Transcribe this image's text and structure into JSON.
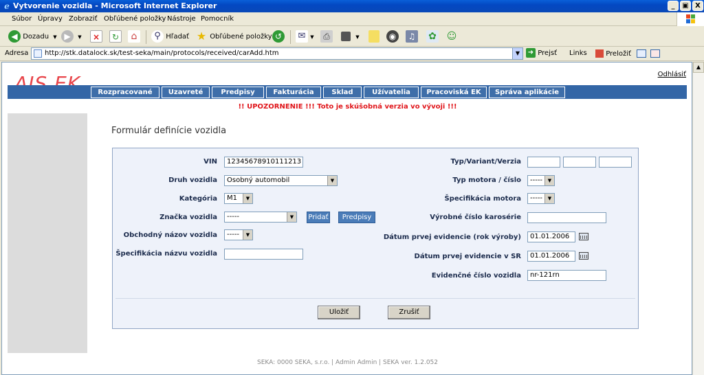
{
  "window": {
    "title": "Vytvorenie vozidla - Microsoft Internet Explorer",
    "minimize": "_",
    "maximize": "▣",
    "close": "X"
  },
  "menu": [
    "Súbor",
    "Úpravy",
    "Zobraziť",
    "Obľúbené položky",
    "Nástroje",
    "Pomocník"
  ],
  "toolbar": {
    "back": "Dozadu",
    "search": "Hľadať",
    "favorites": "Obľúbené položky"
  },
  "address": {
    "label": "Adresa",
    "url": "http://stk.datalock.sk/test-seka/main/protocols/received/carAdd.htm",
    "go": "Prejsť",
    "links": "Links",
    "translate": "Preložiť"
  },
  "page": {
    "logo": "AIS EK",
    "logout": "Odhlásiť",
    "nav": [
      "Rozpracované",
      "Uzavreté",
      "Predpisy",
      "Fakturácia",
      "Sklad",
      "Užívatelia",
      "Pracoviská EK",
      "Správa aplikácie"
    ],
    "warning": "!! UPOZORNENIE !!! Toto je skúšobná verzia vo vývoji !!!",
    "form_title": "Formulár definície vozidla"
  },
  "form": {
    "vin": {
      "label": "VIN",
      "value": "12345678910111213"
    },
    "druh": {
      "label": "Druh vozidla",
      "value": "Osobný automobil"
    },
    "kategoria": {
      "label": "Kategória",
      "value": "M1"
    },
    "znacka": {
      "label": "Značka vozidla",
      "value": "-----"
    },
    "obch_nazov": {
      "label": "Obchodný názov vozidla",
      "value": "-----"
    },
    "spec_nazvu": {
      "label": "Špecifikácia názvu vozidla",
      "value": ""
    },
    "typ": {
      "label": "Typ/Variant/Verzia"
    },
    "typ_motora": {
      "label": "Typ motora / číslo",
      "value": "-----"
    },
    "spec_motora": {
      "label": "Špecifikácia motora",
      "value": "-----"
    },
    "vyrobne_cislo": {
      "label": "Výrobné číslo karosérie",
      "value": ""
    },
    "datum_prvej": {
      "label": "Dátum prvej evidencie (rok výroby)",
      "value": "01.01.2006"
    },
    "datum_sr": {
      "label": "Dátum prvej evidencie v SR",
      "value": "01.01.2006"
    },
    "ev_cislo": {
      "label": "Evidenčné číslo vozidla",
      "value": "nr-121rn"
    },
    "pridat": "Pridať",
    "predpisy": "Predpisy",
    "ulozit": "Uložiť",
    "zrusit": "Zrušiť"
  },
  "footer": "SEKA: 0000 SEKA, s.r.o.   | Admin Admin  |   SEKA ver. 1.2.052"
}
